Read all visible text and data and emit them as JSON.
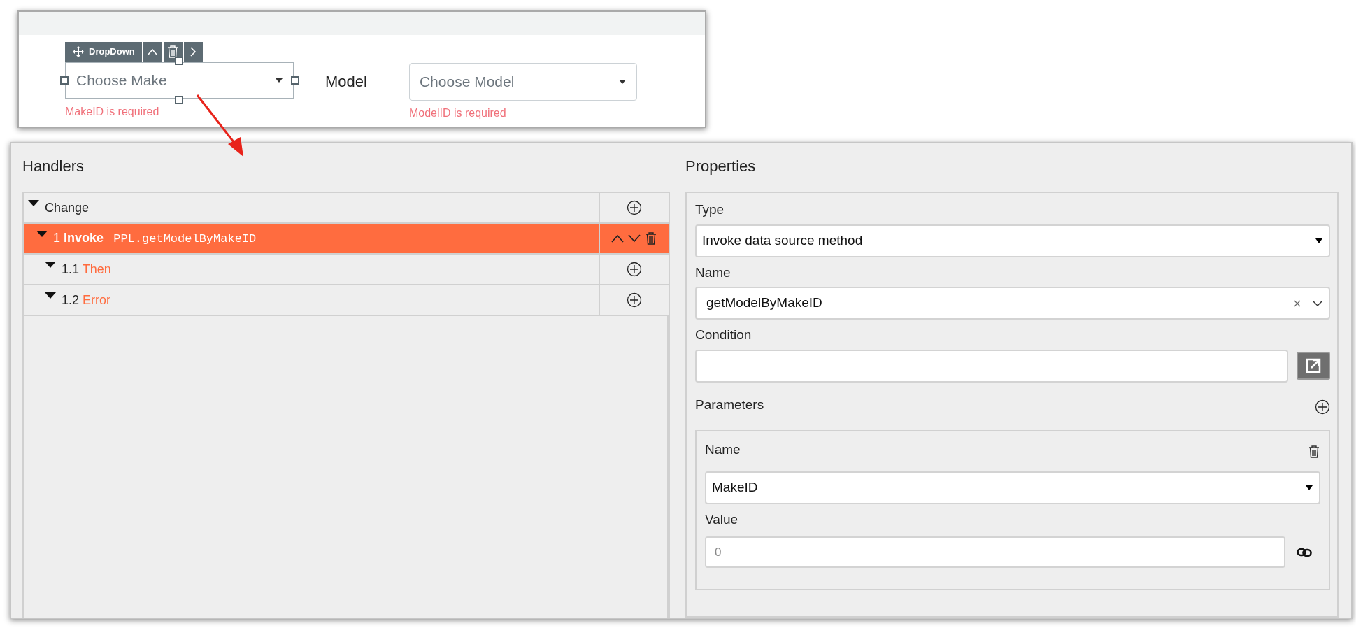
{
  "designer": {
    "toolbar": {
      "label": "DropDown"
    },
    "fields": [
      {
        "kind": "select",
        "placeholder": "Choose Make",
        "error": "MakeID is required",
        "selected": true
      },
      {
        "kind": "label",
        "text": "Model"
      },
      {
        "kind": "select",
        "placeholder": "Choose Model",
        "error": "ModelID is required",
        "selected": false
      }
    ]
  },
  "handlers": {
    "title": "Handlers",
    "rows": [
      {
        "label": "Change",
        "expanded": true,
        "selected": false,
        "children": [
          {
            "number": "1",
            "keyword": "Invoke",
            "target": "PPL.getModelByMakeID",
            "expanded": true,
            "selected": true,
            "children": [
              {
                "number": "1.1",
                "keyword": "Then",
                "expanded": true,
                "selected": false
              },
              {
                "number": "1.2",
                "keyword": "Error",
                "expanded": true,
                "selected": false
              }
            ]
          }
        ]
      }
    ]
  },
  "properties": {
    "title": "Properties",
    "type": {
      "label": "Type",
      "value": "Invoke data source method"
    },
    "name": {
      "label": "Name",
      "value": "getModelByMakeID"
    },
    "condition": {
      "label": "Condition"
    },
    "parameters": {
      "title": "Parameters",
      "items": [
        {
          "name_label": "Name",
          "name_value": "MakeID",
          "value_label": "Value",
          "value_placeholder": "0"
        }
      ]
    }
  }
}
